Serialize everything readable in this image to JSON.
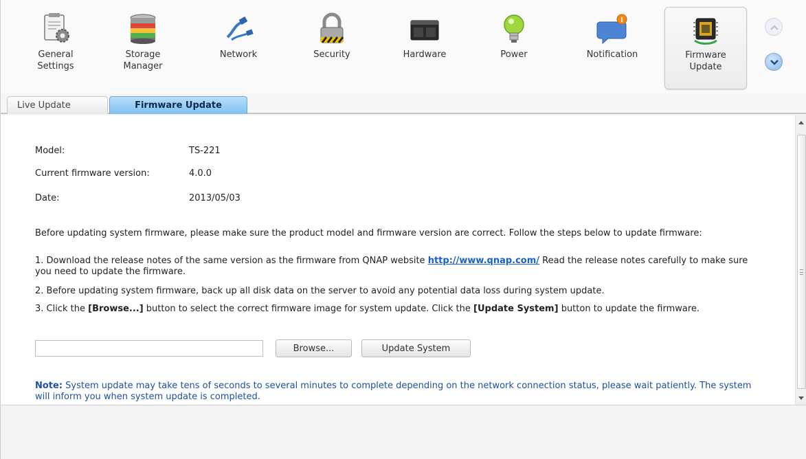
{
  "toolbar": {
    "items": [
      {
        "label": "General\nSettings",
        "icon": "general-settings-icon"
      },
      {
        "label": "Storage\nManager",
        "icon": "storage-manager-icon"
      },
      {
        "label": "Network",
        "icon": "network-icon"
      },
      {
        "label": "Security",
        "icon": "lock-icon"
      },
      {
        "label": "Hardware",
        "icon": "hardware-icon"
      },
      {
        "label": "Power",
        "icon": "power-bulb-icon"
      },
      {
        "label": "Notification",
        "icon": "notification-icon"
      },
      {
        "label": "Firmware\nUpdate",
        "icon": "firmware-chip-icon",
        "active": true
      }
    ]
  },
  "tabs": [
    {
      "label": "Live Update",
      "active": false
    },
    {
      "label": "Firmware Update",
      "active": true
    }
  ],
  "info": {
    "model_label": "Model:",
    "model_value": "TS-221",
    "fw_label": "Current firmware version:",
    "fw_value": "4.0.0",
    "date_label": "Date:",
    "date_value": "2013/05/03"
  },
  "instructions": {
    "intro": "Before updating system firmware, please make sure the product model and firmware version are correct. Follow the steps below to update firmware:",
    "step1_a": "1. Download the release notes of the same version as the firmware from QNAP website ",
    "step1_link": "http://www.qnap.com/",
    "step1_b": " Read the release notes carefully to make sure you need to update the firmware.",
    "step2": "2. Before updating system firmware, back up all disk data on the server to avoid any potential data loss during system update.",
    "step3_a": "3. Click the ",
    "step3_browse": "[Browse...]",
    "step3_b": " button to select the correct firmware image for system update. Click the ",
    "step3_update": "[Update System]",
    "step3_c": " button to update the firmware."
  },
  "form": {
    "file_value": "",
    "browse_label": "Browse...",
    "update_label": "Update System"
  },
  "note": {
    "prefix": "Note:",
    "text": " System update may take tens of seconds to several minutes to complete depending on the network connection status, please wait patiently. The system will inform you when system update is completed."
  },
  "colors": {
    "active_tab": "#7fc0f0",
    "link": "#1a5fd0",
    "note": "#1f4fa0"
  }
}
